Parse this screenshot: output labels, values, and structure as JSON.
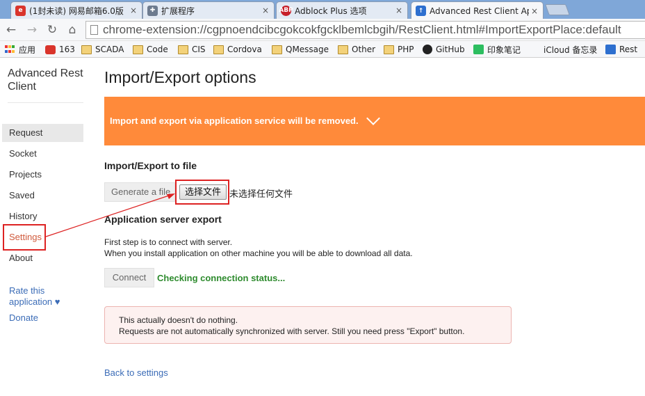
{
  "browser": {
    "tabs": [
      {
        "label": "(1封未读) 网易邮箱6.0版",
        "icon": "netease-mail-icon",
        "close": "×"
      },
      {
        "label": "扩展程序",
        "icon": "puzzle-piece-icon",
        "close": "×"
      },
      {
        "label": "Adblock Plus 选项",
        "icon": "abp-icon",
        "icon_text": "ABP",
        "close": "×"
      },
      {
        "label": "Advanced Rest Client Ap",
        "icon": "rest-client-icon",
        "close": "×"
      }
    ],
    "address": "chrome-extension://cgpnoendcibcgokcokfgcklbemlcbgih/RestClient.html#ImportExportPlace:default",
    "bookmarks": [
      "应用",
      "163",
      "SCADA",
      "Code",
      "CIS",
      "Cordova",
      "QMessage",
      "Other",
      "PHP",
      "GitHub",
      "印象笔记",
      "iCloud 备忘录",
      "Rest"
    ]
  },
  "sidebar": {
    "app_title": "Advanced Rest Client",
    "items": [
      "Request",
      "Socket",
      "Projects",
      "Saved",
      "History",
      "Settings",
      "About"
    ],
    "rate_link": "Rate this application ♥",
    "donate_link": "Donate"
  },
  "main": {
    "title": "Import/Export options",
    "banner_text": "Import and export via application service will be removed.",
    "file_section_title": "Import/Export to file",
    "generate_button": "Generate a file",
    "choose_file_button": "选择文件",
    "no_file_text": "未选择任何文件",
    "server_section_title": "Application server export",
    "server_desc_1": "First step is to connect with server.",
    "server_desc_2": "When you install application on other machine you will be able to download all data.",
    "connect_button": "Connect",
    "connection_status": "Checking connection status...",
    "notice_line_1": "This actually doesn't do nothing.",
    "notice_line_2": "Requests are not automatically synchronized with server. Still you need press \"Export\" button.",
    "back_link": "Back to settings"
  },
  "colors": {
    "banner": "#ff8a3a",
    "status_green": "#2e8b2e",
    "link_blue": "#3b6cb7",
    "annotation_red": "#dd2222"
  }
}
